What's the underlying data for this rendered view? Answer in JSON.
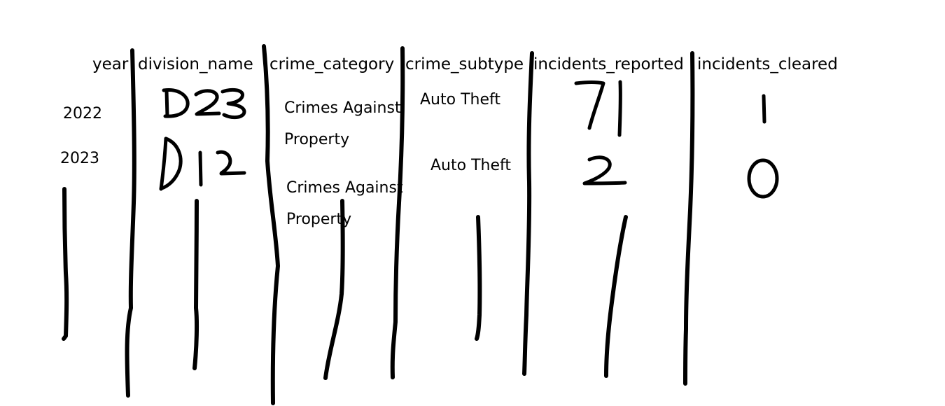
{
  "table": {
    "columns": [
      "year",
      "division_name",
      "crime_category",
      "crime_subtype",
      "incidents_reported",
      "incidents_cleared"
    ],
    "rows": [
      {
        "year": "2022",
        "division_name": "D23",
        "crime_category_line1": "Crimes Against",
        "crime_category_line2": "Property",
        "crime_subtype": "Auto Theft",
        "incidents_reported": "71",
        "incidents_cleared": "1"
      },
      {
        "year": "2023",
        "division_name": "D12",
        "crime_category_line1": "Crimes Against",
        "crime_category_line2": "Property",
        "crime_subtype": "Auto Theft",
        "incidents_reported": "2",
        "incidents_cleared": "0"
      }
    ]
  },
  "ink_color": "#000000"
}
